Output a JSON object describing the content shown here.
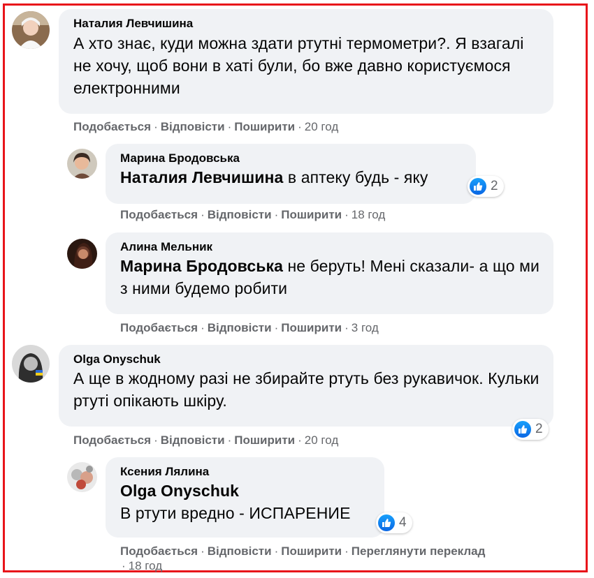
{
  "actions": {
    "like": "Подобається",
    "reply": "Відповісти",
    "share": "Поширити",
    "translate": "Переглянути переклад",
    "sep": "·"
  },
  "colors": {
    "frame": "#e8141a",
    "bubble": "#f0f2f5",
    "like_blue": "#0a66e4",
    "meta_gray": "#65676b"
  },
  "comments": [
    {
      "author": "Наталия Левчишина",
      "text": "А хто знає, куди можна здати ртутні термометри?. Я взагалі не хочу, щоб вони в хаті були, бо вже давно користуємося електронними",
      "time": "20 год"
    },
    {
      "author": "Марина Бродовська",
      "mention": "Наталия Левчишина",
      "text": "в аптеку будь - яку",
      "time": "18 год",
      "reactions": "2"
    },
    {
      "author": "Алина Мельник",
      "mention": "Марина Бродовська",
      "text": "не беруть! Мені сказали- а що ми з ними будемо робити",
      "time": "3 год"
    },
    {
      "author": "Olga Onyschuk",
      "text": "А ще в жодному разі не збирайте ртуть без рукавичок. Кульки ртуті опікають шкіру.",
      "time": "20 год",
      "reactions": "2"
    },
    {
      "author": "Ксения Лялина",
      "mention": "Olga Onyschuk",
      "text": "В ртути вредно - ИСПАРЕНИЕ",
      "time": "18 год",
      "reactions": "4"
    }
  ]
}
